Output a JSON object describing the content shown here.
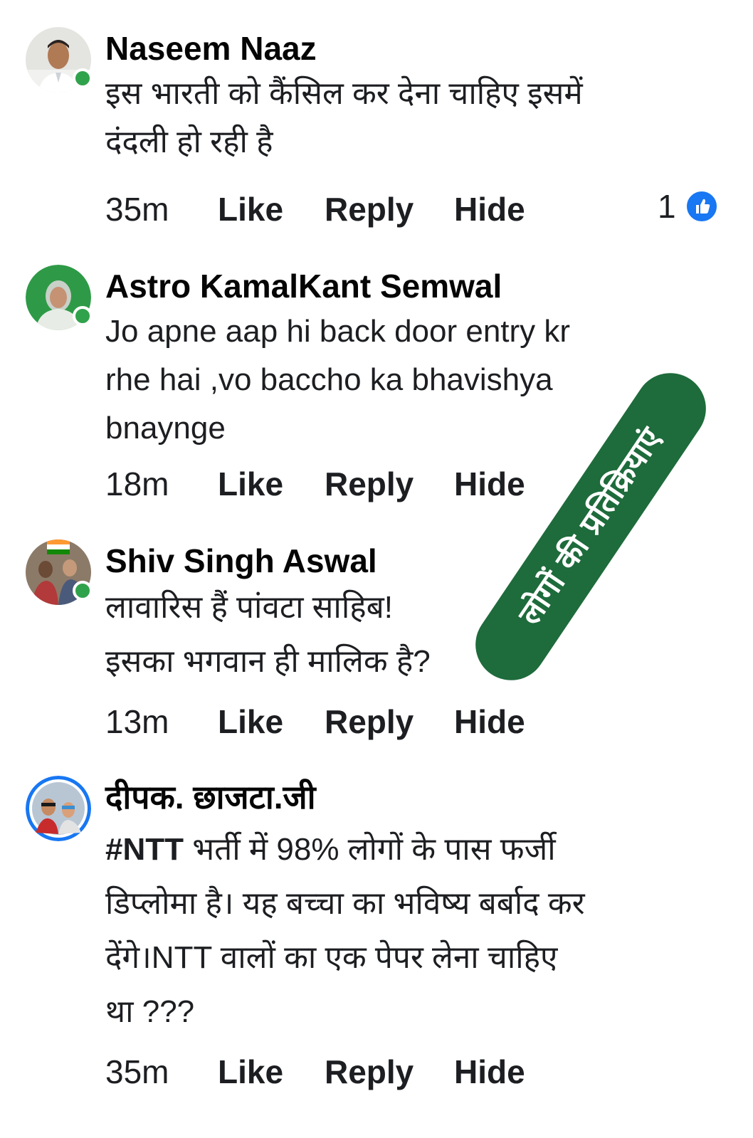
{
  "comments": [
    {
      "author": "Naseem Naaz",
      "lines": [
        "इस भारती को कैंसिल कर देना चाहिए इसमें",
        "दंदली हो रही है"
      ],
      "time": "35m",
      "like": "Like",
      "reply": "Reply",
      "hide": "Hide",
      "reaction_count": "1",
      "online": true
    },
    {
      "author": "Astro KamalKant Semwal",
      "lines": [
        "Jo apne aap hi back door entry kr",
        "rhe hai ,vo baccho ka bhavishya",
        "bnaynge"
      ],
      "time": "18m",
      "like": "Like",
      "reply": "Reply",
      "hide": "Hide",
      "online": true
    },
    {
      "author": "Shiv Singh Aswal",
      "lines": [
        "लावारिस हैं पांवटा साहिब!",
        "इसका भगवान ही मालिक है?"
      ],
      "time": "13m",
      "like": "Like",
      "reply": "Reply",
      "hide": "Hide",
      "online": true
    },
    {
      "author": "दीपक. छाजटा.जी",
      "hashtag": "#NTT",
      "lines": [
        " भर्ती में 98% लोगों के पास फर्जी",
        "डिप्लोमा है। यह बच्चा का भविष्य बर्बाद कर",
        "देंगे।NTT वालों का एक पेपर लेना चाहिए",
        "था ???"
      ],
      "time": "35m",
      "like": "Like",
      "reply": "Reply",
      "hide": "Hide",
      "online": false
    }
  ],
  "overlay": {
    "text": "लोगों की प्रतिक्रियाएं",
    "color": "#1e6b3b"
  },
  "colors": {
    "online": "#31a24c",
    "like_badge": "#1877f2"
  },
  "icons": {
    "reaction": "thumbs-up-icon"
  }
}
